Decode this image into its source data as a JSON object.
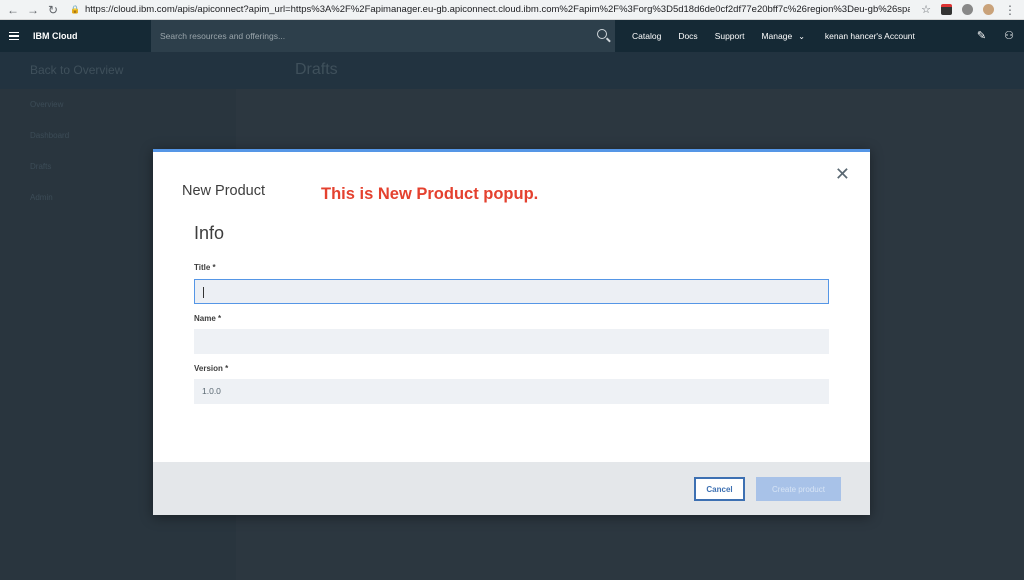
{
  "browser": {
    "url": "https://cloud.ibm.com/apis/apiconnect?apim_url=https%3A%2F%2Fapimanager.eu-gb.apiconnect.cloud.ibm.com%2Fapim%2F%3Forg%3D5d18d6de0cf2df77e20bff7c%26region%3Deu-gb%26spaceId..."
  },
  "header": {
    "brand": "IBM Cloud",
    "search_placeholder": "Search resources and offerings...",
    "nav": [
      "Catalog",
      "Docs",
      "Support",
      "Manage"
    ],
    "account": "kenan hancer's Account"
  },
  "background": {
    "back_link": "Back to Overview",
    "page_title": "Drafts",
    "sidebar_items": [
      "Overview",
      "Dashboard",
      "Drafts",
      "Admin"
    ]
  },
  "modal": {
    "title": "New Product",
    "annotation": "This is New Product popup.",
    "section": "Info",
    "fields": {
      "title_label": "Title *",
      "title_value": "",
      "name_label": "Name *",
      "name_value": "",
      "version_label": "Version *",
      "version_value": "1.0.0"
    },
    "cancel_label": "Cancel",
    "create_label": "Create product"
  },
  "colors": {
    "annotation": "#e4412f",
    "primary": "#3d70b2",
    "header_bg": "#152935"
  }
}
